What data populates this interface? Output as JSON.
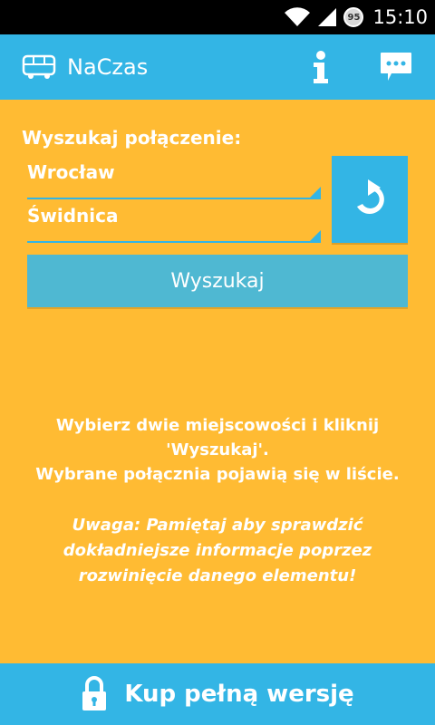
{
  "status_bar": {
    "time": "15:10",
    "battery_level": "95",
    "icons": [
      "wifi-icon",
      "signal-icon",
      "battery-icon"
    ]
  },
  "action_bar": {
    "app_icon": "bus-icon",
    "title": "NaCzas",
    "info_icon": "info-icon",
    "chat_icon": "chat-icon"
  },
  "search": {
    "label": "Wyszukaj połączenie:",
    "from_value": "Wrocław",
    "to_value": "Świdnica",
    "swap_icon": "swap-icon",
    "button_label": "Wyszukaj"
  },
  "info": {
    "line1": "Wybierz dwie miejscowości i kliknij",
    "line2": "'Wyszukaj'.",
    "line3": "Wybrane połącznia pojawią się w liście.",
    "warning": "Uwaga: Pamiętaj aby sprawdzić dokładniejsze informacje poprzez rozwinięcie danego elementu!"
  },
  "footer": {
    "lock_icon": "lock-icon",
    "buy_label": "Kup pełną wersję"
  },
  "colors": {
    "accent": "#33B5E5",
    "background": "#FFBB33",
    "button": "#4FB8D2"
  }
}
